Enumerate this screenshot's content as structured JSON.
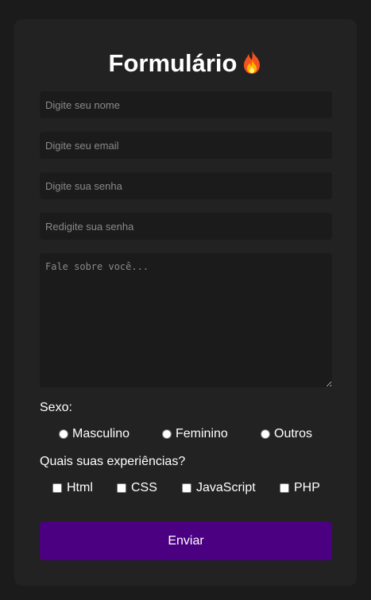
{
  "form": {
    "title": "Formulário",
    "title_icon": "fire-icon",
    "name_placeholder": "Digite seu nome",
    "email_placeholder": "Digite seu email",
    "password_placeholder": "Digite sua senha",
    "confirm_password_placeholder": "Redigite sua senha",
    "about_placeholder": "Fale sobre você...",
    "gender_label": "Sexo:",
    "gender_options": [
      "Masculino",
      "Feminino",
      "Outros"
    ],
    "experience_label": "Quais suas experiências?",
    "experience_options": [
      "Html",
      "CSS",
      "JavaScript",
      "PHP"
    ],
    "submit_label": "Enviar"
  },
  "colors": {
    "page_background": "#1b1b1b",
    "card_background": "#222222",
    "input_background": "#1b1b1b",
    "accent": "#4b0082",
    "text": "#ffffff",
    "placeholder": "#8a8a8a"
  }
}
